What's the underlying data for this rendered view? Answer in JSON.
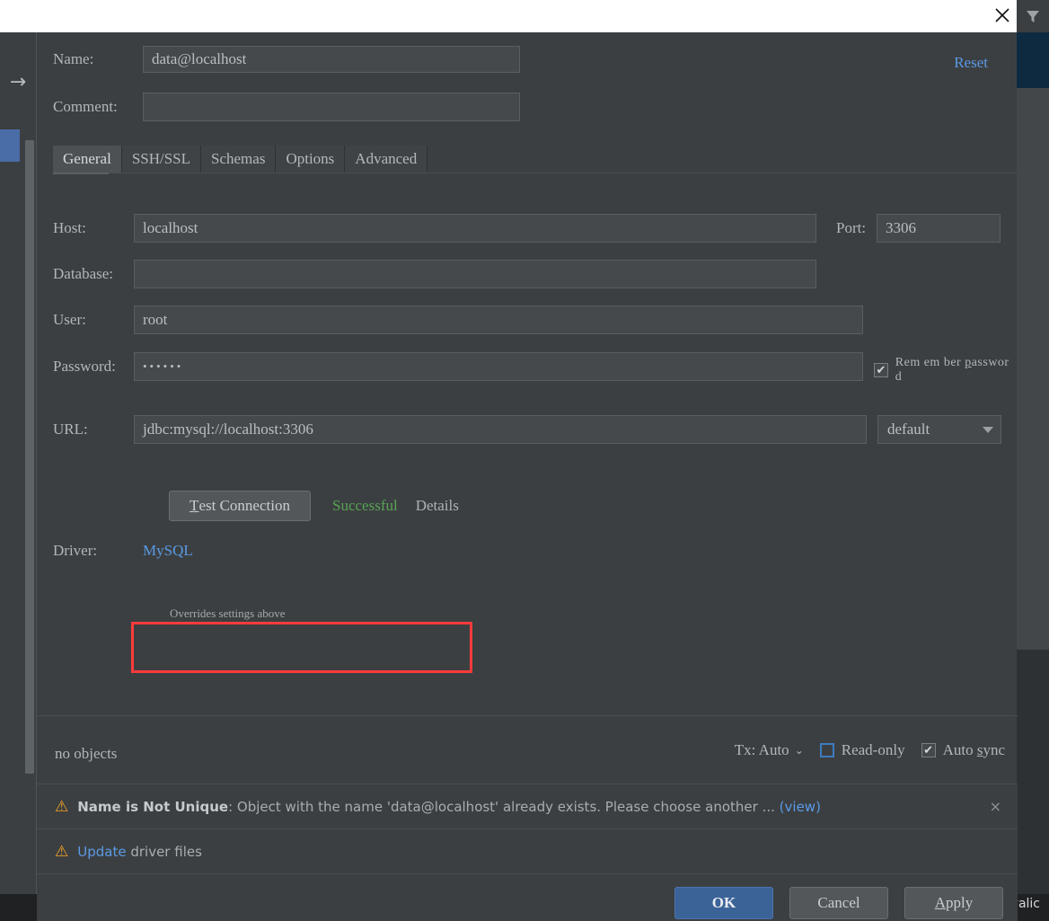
{
  "window": {
    "close_icon": "close-icon",
    "filter_icon": "filter-icon",
    "back_arrow_icon": "arrow-right-icon",
    "watermark": "https://blog.csdn.net/Royalic"
  },
  "dialog": {
    "reset_label": "Reset",
    "name_label": "Name:",
    "name_value": "data@localhost",
    "name_placeholder": "",
    "comment_label": "Comment:",
    "comment_value": "",
    "comment_placeholder": "",
    "expand_icon": "expand-icon"
  },
  "tabs": [
    {
      "label": "General",
      "active": true
    },
    {
      "label": "SSH/SSL",
      "active": false
    },
    {
      "label": "Schemas",
      "active": false
    },
    {
      "label": "Options",
      "active": false
    },
    {
      "label": "Advanced",
      "active": false
    }
  ],
  "general": {
    "host_label": "Host:",
    "host_value": "localhost",
    "port_label": "Port:",
    "port_value": "3306",
    "database_label": "Database:",
    "database_value": "",
    "user_label": "User:",
    "user_value": "root",
    "password_label": "Password:",
    "password_value": "••••••",
    "remember_password": {
      "label_pre": "Rem em ber ",
      "label_mnemonic": "p",
      "label_post": "asswor d",
      "checked": true,
      "check_glyph": "✔"
    },
    "url_label": "URL:",
    "url_value": "jdbc:mysql://localhost:3306",
    "url_hint": "Overrides settings above",
    "schema_combo_value": "default",
    "test_connection": {
      "mnemonic": "T",
      "label_rest": "est Connection"
    },
    "test_status": "Successful",
    "test_status_color": "#57a355",
    "details_label": "Details",
    "driver_label": "Driver:",
    "driver_value": "MySQL",
    "driver_link_color": "#5a9ae6",
    "highlight_color": "#fb3b3b"
  },
  "status": {
    "objects": "no objects",
    "tx_label": "Tx: Auto",
    "tx_caret": "⌄",
    "readonly": {
      "label": "Read-only",
      "checked": false
    },
    "autosync": {
      "label_pre": "Auto ",
      "label_mnemonic": "s",
      "label_post": "ync",
      "checked": true,
      "check_glyph": "✔"
    }
  },
  "warnings": [
    {
      "icon": "warning-icon",
      "title": "Name is Not Unique",
      "body": ": Object with the name 'data@localhost' already exists. Please choose another ... ",
      "link": "(view)",
      "close_glyph": "×",
      "dismissible": true
    },
    {
      "icon": "warning-icon",
      "title": "",
      "link_first": "Update",
      "body": " driver files",
      "dismissible": false
    }
  ],
  "footer": {
    "ok_label": "OK",
    "cancel_label": "Cancel",
    "apply_mnemonic": "A",
    "apply_rest": "pply"
  }
}
